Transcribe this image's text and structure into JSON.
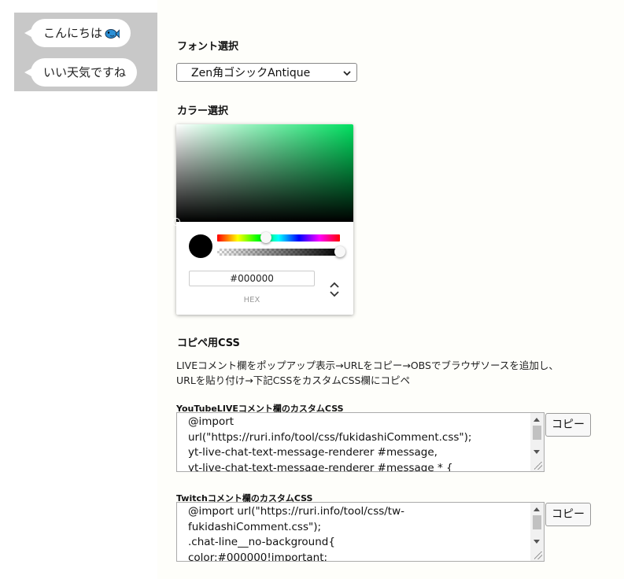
{
  "preview": {
    "messages": [
      "こんにちは",
      "いい天気ですね"
    ]
  },
  "font_section": {
    "heading": "フォント選択",
    "selected": "Zen角ゴシックAntique"
  },
  "color_section": {
    "heading": "カラー選択",
    "hex_value": "#000000",
    "hex_label": "HEX",
    "hue_position": 0.4,
    "alpha_position": 1.0
  },
  "css_section": {
    "heading": "コピペ用CSS",
    "description_lines": [
      "LIVEコメント欄をポップアップ表示→URLをコピー→OBSでブラウザソースを追加し、",
      "URLを貼り付け→下記CSSをカスタムCSS欄にコピペ"
    ],
    "youtube": {
      "label": "YouTubeLIVEコメント欄のカスタムCSS",
      "code": "@import\nurl(\"https://ruri.info/tool/css/fukidashiComment.css\");\nyt-live-chat-text-message-renderer #message,\nyt-live-chat-text-message-renderer #message * {",
      "copy_label": "コピー"
    },
    "twitch": {
      "label": "Twitchコメント欄のカスタムCSS",
      "code": "@import url(\"https://ruri.info/tool/css/tw-\nfukidashiComment.css\");\n.chat-line__no-background{\ncolor:#000000!important;",
      "copy_label": "コピー"
    }
  },
  "colors": {
    "accent_green": "#00e060",
    "preview_bg": "#c8c8c8",
    "page_bg": "#fefefa"
  }
}
